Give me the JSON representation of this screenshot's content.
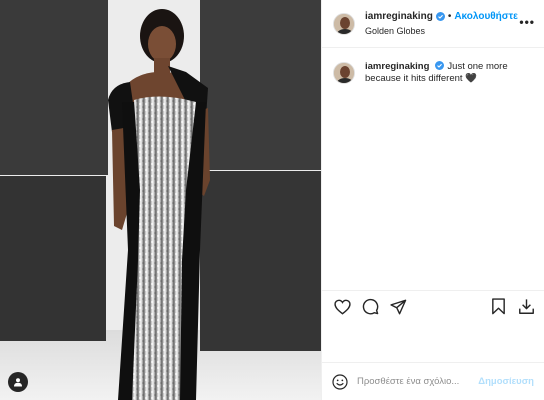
{
  "post": {
    "username": "iamreginaking",
    "follow_label": "Ακολουθήστε",
    "separator": "•",
    "location": "Golden Globes",
    "more_label": "•••"
  },
  "caption": {
    "username": "iamreginaking",
    "text": "Just one more because it hits different",
    "emoji": "🖤"
  },
  "actions": {
    "like_icon": "heart-icon",
    "comment_icon": "comment-icon",
    "share_icon": "paper-plane-icon",
    "save_icon": "bookmark-icon",
    "download_icon": "download-icon"
  },
  "comment_box": {
    "placeholder": "Προσθέστε ένα σχόλιο...",
    "post_label": "Δημοσίευση"
  },
  "colors": {
    "accent": "#0095f6",
    "disabled_accent": "#b2dffc",
    "border": "#efefef"
  }
}
